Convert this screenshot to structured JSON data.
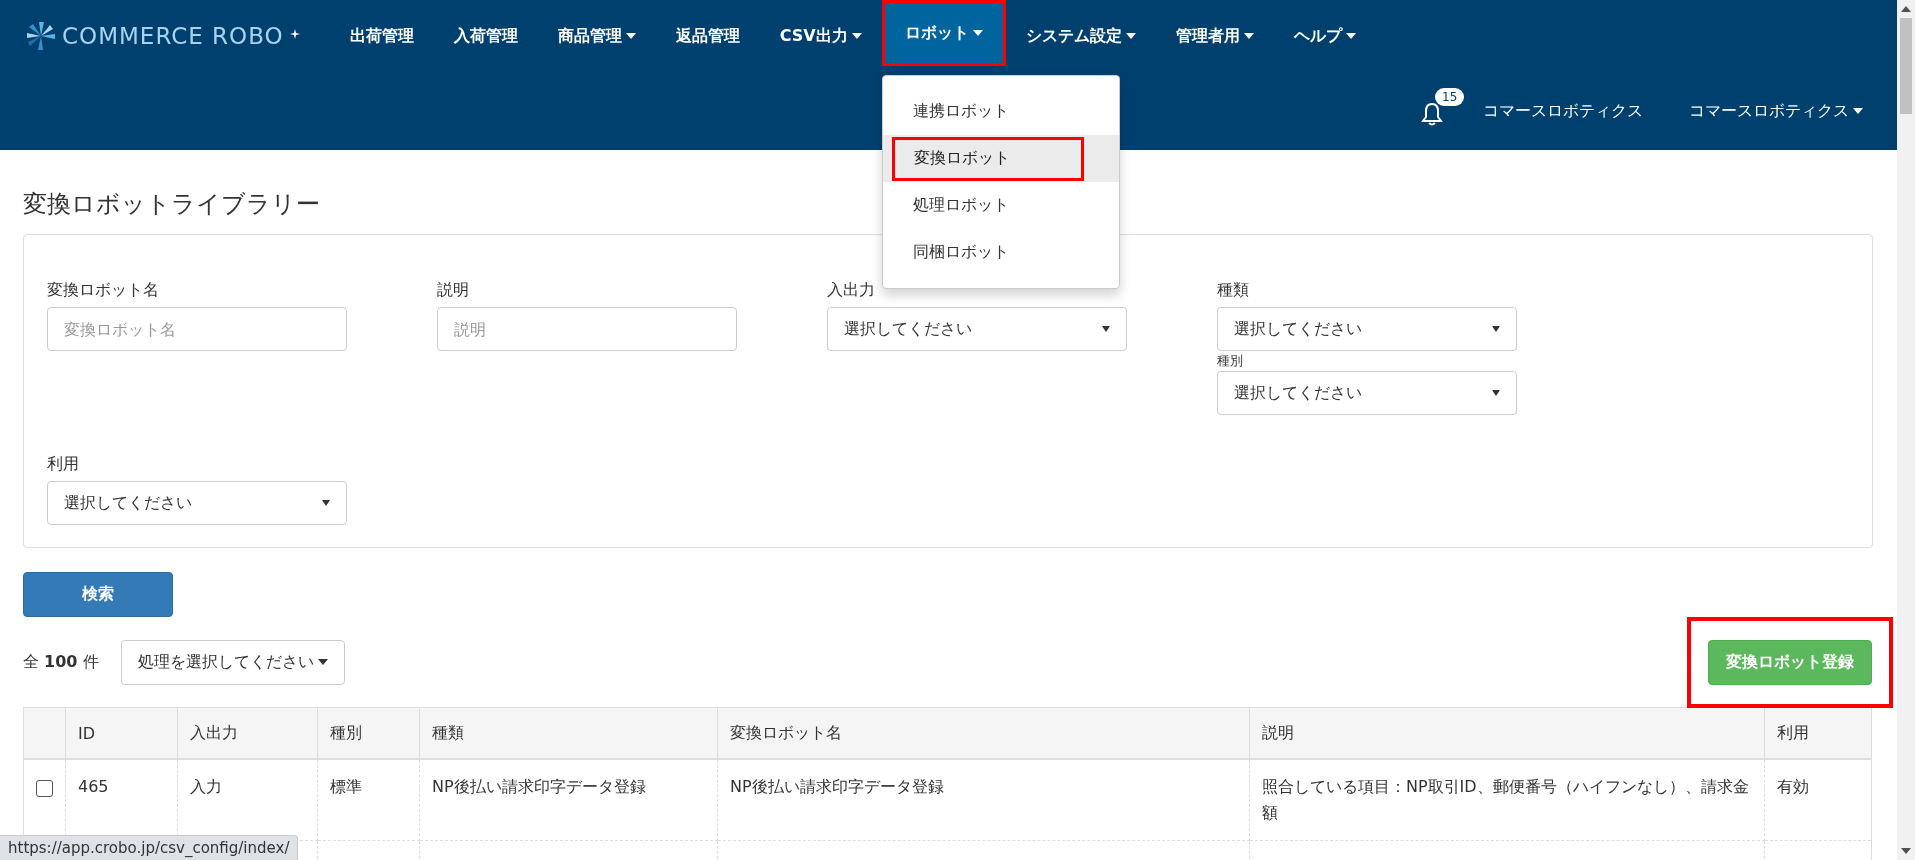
{
  "header": {
    "logo_text": "COMMERCE ROBO",
    "nav": [
      {
        "label": "出荷管理",
        "has_caret": false,
        "open": false,
        "highlighted": false
      },
      {
        "label": "入荷管理",
        "has_caret": false,
        "open": false,
        "highlighted": false
      },
      {
        "label": "商品管理",
        "has_caret": true,
        "open": false,
        "highlighted": false
      },
      {
        "label": "返品管理",
        "has_caret": false,
        "open": false,
        "highlighted": false
      },
      {
        "label": "CSV出力",
        "has_caret": true,
        "open": false,
        "highlighted": false
      },
      {
        "label": "ロボット",
        "has_caret": true,
        "open": true,
        "highlighted": true,
        "menu": [
          {
            "label": "連携ロボット",
            "selected": false,
            "highlighted": false
          },
          {
            "label": "変換ロボット",
            "selected": true,
            "highlighted": true
          },
          {
            "label": "処理ロボット",
            "selected": false,
            "highlighted": false
          },
          {
            "label": "同梱ロボット",
            "selected": false,
            "highlighted": false
          }
        ]
      },
      {
        "label": "システム設定",
        "has_caret": true,
        "open": false,
        "highlighted": false
      },
      {
        "label": "管理者用",
        "has_caret": true,
        "open": false,
        "highlighted": false
      },
      {
        "label": "ヘルプ",
        "has_caret": true,
        "open": false,
        "highlighted": false
      }
    ],
    "notification_count": "15",
    "company": "コマースロボティクス",
    "user": "コマースロボティクス"
  },
  "page_title": "変換ロボットライブラリー",
  "filters": [
    {
      "label": "変換ロボット名",
      "kind": "text",
      "placeholder": "変換ロボット名"
    },
    {
      "label": "説明",
      "kind": "text",
      "placeholder": "説明"
    },
    {
      "label": "入出力",
      "kind": "select",
      "value": "選択してください"
    },
    {
      "label": "種類",
      "kind": "select",
      "value": "選択してください"
    },
    {
      "label": "種別",
      "kind": "select",
      "value": "選択してください"
    },
    {
      "label": "利用",
      "kind": "select",
      "value": "選択してください"
    }
  ],
  "search_button": "検索",
  "count": {
    "prefix": "全",
    "number": "100",
    "suffix": "件"
  },
  "bulk_action": "処理を選択してください",
  "register_button": {
    "label": "変換ロボット登録",
    "highlighted": true
  },
  "table": {
    "columns": [
      "ID",
      "入出力",
      "種別",
      "種類",
      "変換ロボット名",
      "説明",
      "利用"
    ],
    "rows": [
      {
        "checked": false,
        "cells": [
          "465",
          "入力",
          "標準",
          "NP後払い請求印字データ登録",
          "NP後払い請求印字データ登録",
          "照合している項目：NP取引ID、郵便番号（ハイフンなし）、請求金額",
          "有効"
        ]
      }
    ]
  },
  "status_url": "https://app.crobo.jp/csv_config/index/"
}
